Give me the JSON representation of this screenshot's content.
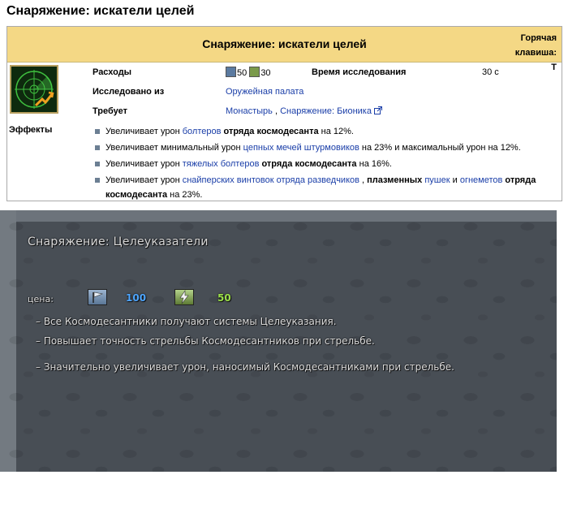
{
  "page": {
    "title": "Снаряжение: искатели целей"
  },
  "infobox": {
    "title": "Снаряжение: искатели целей",
    "hotkey": "Горячая клавиша: T",
    "rows": {
      "cost_label": "Расходы",
      "cost_requisition": "50",
      "cost_power": "30",
      "research_time_label": "Время исследования",
      "research_time_value": "30 с",
      "researched_from_label": "Исследовано из",
      "researched_from_value": "Оружейная палата",
      "requires_label": "Требует",
      "requires_1": "Монастырь",
      "requires_sep": ",",
      "requires_2": "Снаряжение: Бионика"
    },
    "effects_label": "Эффекты",
    "effects": [
      {
        "t1": "Увеличивает урон ",
        "l1": "болтеров",
        "b1": " отряда космодесанта",
        "t2": " на 12%."
      },
      {
        "t1": "Увеличивает минимальный урон ",
        "l1": "цепных мечей штурмовиков",
        "t2": " на 23% и максимальный урон на 12%."
      },
      {
        "t1": "Увеличивает урон ",
        "l1": "тяжелых болтеров",
        "b1": " отряда космодесанта",
        "t2": " на 16%."
      },
      {
        "t1": "Увеличивает урон ",
        "l1": "снайперских винтовок отряда разведчиков",
        "t2": " , ",
        "b1": "плазменных",
        "t3": " ",
        "l2": "пушек",
        "t4": " и ",
        "l3": "огнеметов",
        "b2": " отряда космодесанта",
        "t5": " на 23%."
      }
    ]
  },
  "game_tooltip": {
    "title": "Снаряжение: Целеуказатели",
    "cost_label": "цена:",
    "requisition": "100",
    "power": "50",
    "lines": [
      "– Все Космодесантники получают системы Целеуказания.",
      "– Повышает точность стрельбы Космодесантников при стрельбе.",
      "– Значительно увеличивает урон, наносимый Космодесантниками при стрельбе."
    ],
    "colors": {
      "requisition": "#4ea6ff",
      "power": "#9be04a"
    }
  },
  "icons": {
    "portrait": "radar-targeting-icon",
    "requisition": "flag-icon",
    "power": "lightning-icon",
    "external_link": "external-link-icon"
  }
}
